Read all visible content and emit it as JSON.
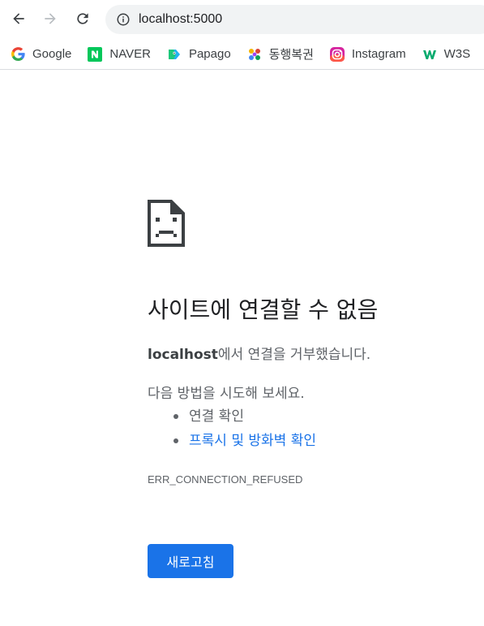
{
  "browser": {
    "url": "localhost:5000",
    "bookmarks": [
      {
        "label": "Google",
        "icon": "google-icon"
      },
      {
        "label": "NAVER",
        "icon": "naver-icon"
      },
      {
        "label": "Papago",
        "icon": "papago-icon"
      },
      {
        "label": "동행복권",
        "icon": "lottery-icon"
      },
      {
        "label": "Instagram",
        "icon": "instagram-icon"
      },
      {
        "label": "W3S",
        "icon": "w3schools-icon"
      }
    ]
  },
  "error_page": {
    "icon": "sad-document-icon",
    "title": "사이트에 연결할 수 없음",
    "host": "localhost",
    "description_suffix": "에서 연결을 거부했습니다.",
    "try_label": "다음 방법을 시도해 보세요.",
    "suggestions": [
      {
        "label": "연결 확인",
        "link": false
      },
      {
        "label": "프록시 및 방화벽 확인",
        "link": true
      }
    ],
    "error_code": "ERR_CONNECTION_REFUSED",
    "reload_label": "새로고침"
  },
  "colors": {
    "accent": "#1a73e8",
    "text_secondary": "#5f6368",
    "omnibox_bg": "#f1f3f4"
  }
}
